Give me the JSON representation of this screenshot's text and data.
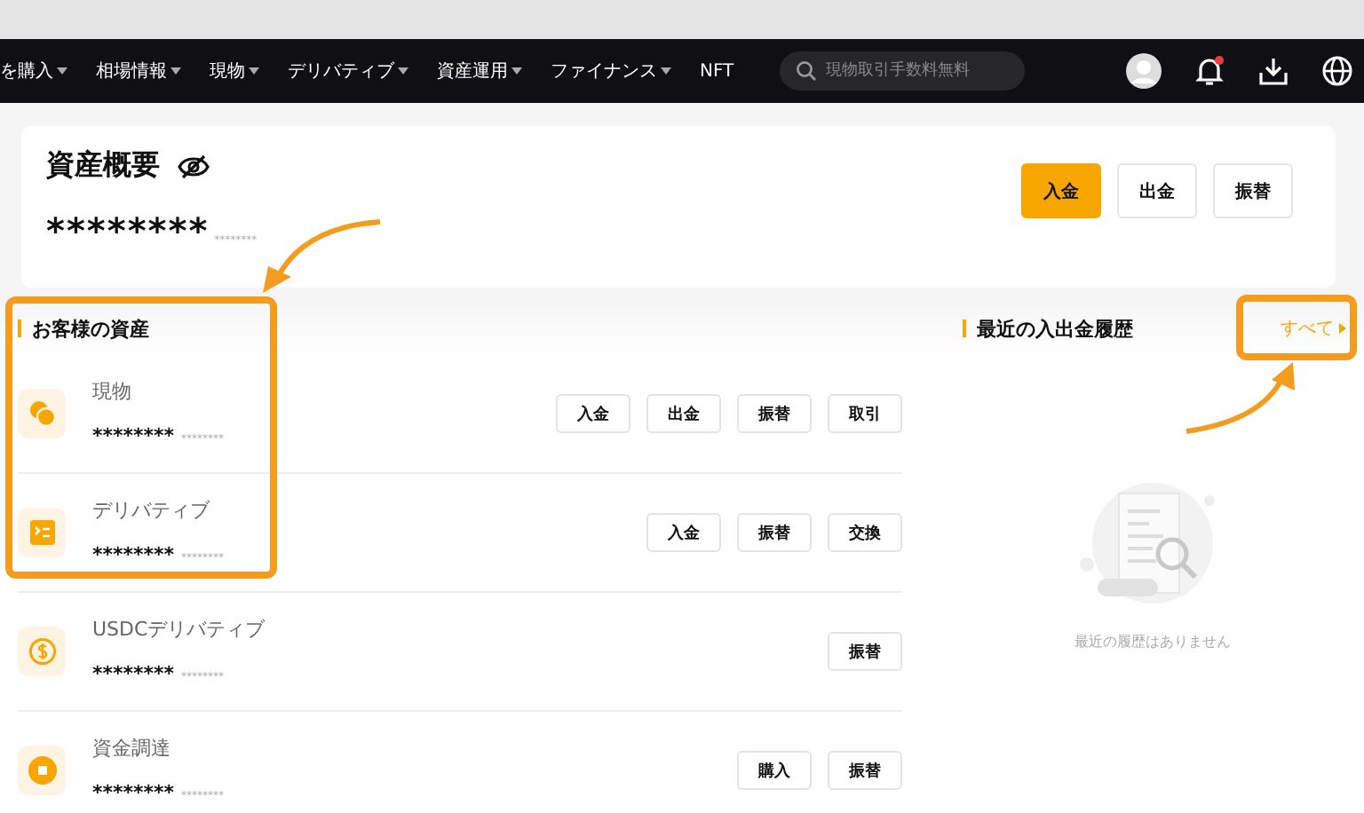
{
  "nav": {
    "items": [
      {
        "label": "を購入",
        "dropdown": true
      },
      {
        "label": "相場情報",
        "dropdown": true
      },
      {
        "label": "現物",
        "dropdown": true
      },
      {
        "label": "デリバティブ",
        "dropdown": true
      },
      {
        "label": "資産運用",
        "dropdown": true
      },
      {
        "label": "ファイナンス",
        "dropdown": true
      },
      {
        "label": "NFT",
        "dropdown": false
      }
    ],
    "search": {
      "placeholder": "現物取引手数料無料"
    },
    "notification_dot": true
  },
  "overview": {
    "title": "資産概要",
    "balance": "********",
    "balance_sub": "********",
    "buttons": [
      {
        "label": "入金",
        "primary": true
      },
      {
        "label": "出金",
        "primary": false
      },
      {
        "label": "振替",
        "primary": false
      }
    ]
  },
  "assets": {
    "title": "お客様の資産",
    "rows": [
      {
        "kind": "spot",
        "name": "現物",
        "balance": "********",
        "balance_sub": "********",
        "buttons": [
          "入金",
          "出金",
          "振替",
          "取引"
        ]
      },
      {
        "kind": "derivatives",
        "name": "デリバティブ",
        "balance": "********",
        "balance_sub": "********",
        "buttons": [
          "入金",
          "振替",
          "交換"
        ]
      },
      {
        "kind": "usdc",
        "name": "USDCデリバティブ",
        "balance": "********",
        "balance_sub": "********",
        "buttons": [
          "振替"
        ]
      },
      {
        "kind": "funding",
        "name": "資金調達",
        "balance": "********",
        "balance_sub": "********",
        "buttons": [
          "購入",
          "振替"
        ]
      }
    ]
  },
  "history": {
    "title": "最近の入出金履歴",
    "link": "すべて",
    "empty_text": "最近の履歴はありません"
  }
}
